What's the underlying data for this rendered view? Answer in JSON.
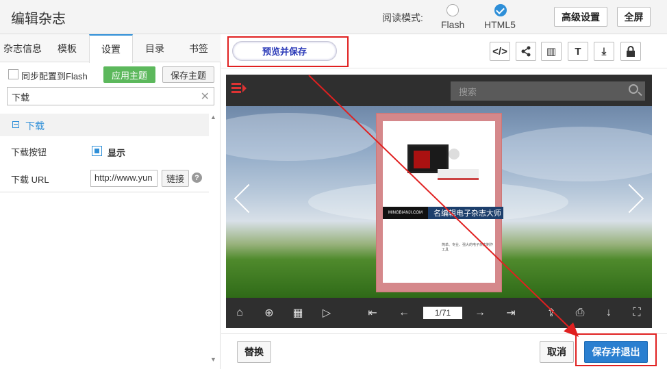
{
  "header": {
    "title": "编辑杂志",
    "read_mode_label": "阅读模式:",
    "modes": [
      {
        "label": "Flash",
        "selected": false
      },
      {
        "label": "HTML5",
        "selected": true
      }
    ],
    "advanced_button": "高级设置",
    "fullscreen_button": "全屏"
  },
  "left": {
    "tabs": [
      "杂志信息",
      "模板",
      "设置",
      "目录",
      "书签"
    ],
    "active_tab": "设置",
    "sync_flash_label": "同步配置到Flash",
    "apply_theme_button": "应用主题",
    "save_theme_button": "保存主题",
    "search_value": "下载",
    "section_title": "下载",
    "download_button_label": "下载按钮",
    "download_button_value": "显示",
    "download_url_label": "下载 URL",
    "download_url_value": "http://www.yun",
    "link_button": "链接",
    "help_icon": "?"
  },
  "toolbar": {
    "preview_save_button": "预览并保存",
    "icons": [
      "code-icon",
      "share-icon",
      "columns-icon",
      "text-icon",
      "download-icon",
      "lock-icon"
    ],
    "icon_glyphs": [
      "</>",
      "⋖",
      "▥",
      "T",
      "⤓",
      "🔒"
    ]
  },
  "viewer": {
    "search_placeholder": "搜索",
    "page_indicator": "1/71",
    "cover": {
      "site_text": "MINGBIANJI.COM",
      "title": "名编辑电子杂志大师",
      "caption": "简单、专业、强大的电子杂志制作工具"
    },
    "bottom_icons": [
      {
        "name": "home-icon",
        "glyph": "⌂"
      },
      {
        "name": "zoom-in-icon",
        "glyph": "⊕"
      },
      {
        "name": "thumbnails-icon",
        "glyph": "▦"
      },
      {
        "name": "play-icon",
        "glyph": "▷"
      },
      {
        "name": "first-page-icon",
        "glyph": "⇤"
      },
      {
        "name": "prev-page-icon",
        "glyph": "←"
      },
      {
        "name": "next-page-icon",
        "glyph": "→"
      },
      {
        "name": "last-page-icon",
        "glyph": "⇥"
      },
      {
        "name": "share-page-icon",
        "glyph": "⇪"
      },
      {
        "name": "print-icon",
        "glyph": "⎙"
      },
      {
        "name": "download-page-icon",
        "glyph": "↓"
      },
      {
        "name": "fullscreen-icon",
        "glyph": "⛶"
      }
    ]
  },
  "footer": {
    "replace_button": "替换",
    "cancel_button": "取消",
    "save_exit_button": "保存并退出"
  },
  "colors": {
    "accent": "#2e8fd8",
    "green": "#5cb85c",
    "highlight": "#e02020"
  }
}
